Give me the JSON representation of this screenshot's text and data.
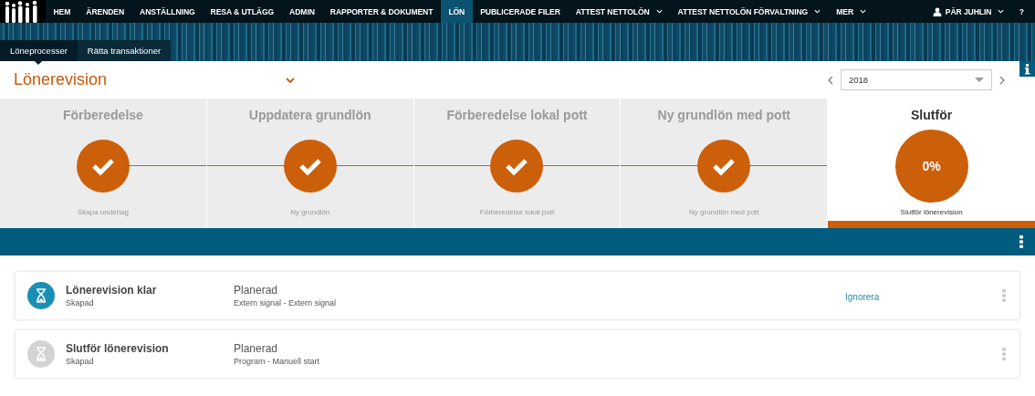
{
  "nav": {
    "items": [
      {
        "label": "HEM",
        "selected": false,
        "has_menu": false
      },
      {
        "label": "ÄRENDEN",
        "selected": false,
        "has_menu": false
      },
      {
        "label": "ANSTÄLLNING",
        "selected": false,
        "has_menu": false
      },
      {
        "label": "RESA & UTLÄGG",
        "selected": false,
        "has_menu": false
      },
      {
        "label": "ADMIN",
        "selected": false,
        "has_menu": false
      },
      {
        "label": "RAPPORTER & DOKUMENT",
        "selected": false,
        "has_menu": false
      },
      {
        "label": "LÖN",
        "selected": true,
        "has_menu": false
      },
      {
        "label": "PUBLICERADE FILER",
        "selected": false,
        "has_menu": false
      },
      {
        "label": "ATTEST NETTOLÖN",
        "selected": false,
        "has_menu": true
      },
      {
        "label": "ATTEST NETTOLÖN FÖRVALTNING",
        "selected": false,
        "has_menu": true
      },
      {
        "label": "MER",
        "selected": false,
        "has_menu": true
      }
    ],
    "user": "PÄR JUHLIN",
    "help": "?"
  },
  "subtabs": [
    {
      "label": "Löneprocesser",
      "selected": true
    },
    {
      "label": "Rätta transaktioner",
      "selected": false
    }
  ],
  "header": {
    "title": "Lönerevision",
    "year": "2018"
  },
  "steps": [
    {
      "title": "Förberedelse",
      "subtitle": "Skapa underlag",
      "done": true,
      "selected": false
    },
    {
      "title": "Uppdatera grundlön",
      "subtitle": "Ny grundlön",
      "done": true,
      "selected": false
    },
    {
      "title": "Förberedelse lokal pott",
      "subtitle": "Förberedelse lokal pott",
      "done": true,
      "selected": false
    },
    {
      "title": "Ny grundlön med pott",
      "subtitle": "Ny grundlön med pott",
      "done": true,
      "selected": false
    },
    {
      "title": "Slutför",
      "subtitle": "Slutför lönerevision",
      "done": false,
      "selected": true,
      "progress": "0%"
    }
  ],
  "tasks": [
    {
      "title": "Lönerevision klar",
      "state": "Skapad",
      "status": "Planerad",
      "trigger": "Extern signal - Extern signal",
      "active": true,
      "action": "Ignorera"
    },
    {
      "title": "Slutför lönerevision",
      "state": "Skapad",
      "status": "Planerad",
      "trigger": "Program - Manuell start",
      "active": false
    }
  ]
}
